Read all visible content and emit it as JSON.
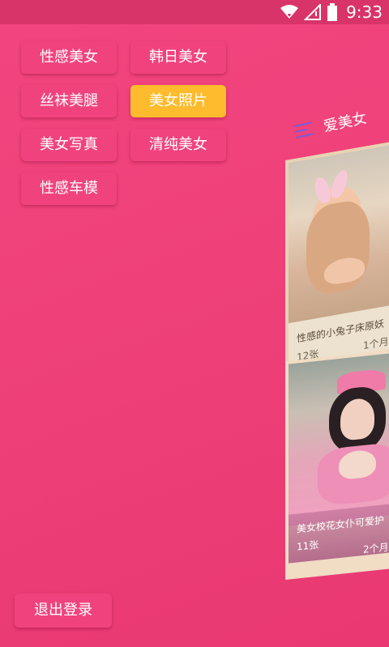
{
  "status_bar": {
    "time": "9:33"
  },
  "categories": [
    {
      "label": "性感美女",
      "active": false
    },
    {
      "label": "韩日美女",
      "active": false
    },
    {
      "label": "丝袜美腿",
      "active": false
    },
    {
      "label": "美女照片",
      "active": true
    },
    {
      "label": "美女写真",
      "active": false
    },
    {
      "label": "清纯美女",
      "active": false
    },
    {
      "label": "性感车模",
      "active": false
    }
  ],
  "logout_label": "退出登录",
  "colors": {
    "background": "#ee3f78",
    "tag": "#f0437e",
    "active_tag": "#fdbb2d",
    "status_bar": "#d8346a"
  },
  "preview": {
    "title": "爱美女",
    "cards": [
      {
        "caption": "性感的小兔子床原妖",
        "count": "12张",
        "time": "1个月"
      },
      {
        "caption": "美女校花女仆可爱护",
        "count": "11张",
        "time": "2个月"
      }
    ]
  }
}
